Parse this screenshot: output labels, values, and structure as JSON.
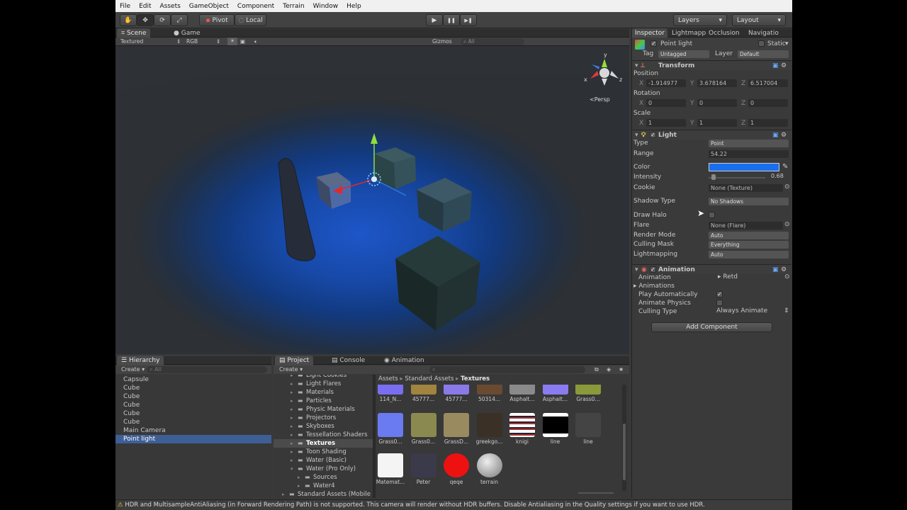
{
  "menubar": {
    "items": [
      "File",
      "Edit",
      "Assets",
      "GameObject",
      "Component",
      "Terrain",
      "Window",
      "Help"
    ]
  },
  "toolbar": {
    "hand_icon": "✋",
    "move_icon": "✥",
    "rotate_icon": "⟳",
    "scale_icon": "⤢",
    "pivot_label": "Pivot",
    "local_label": "Local",
    "play_icon": "▶",
    "pause_icon": "❚❚",
    "step_icon": "▶❚",
    "layers_label": "Layers",
    "layout_label": "Layout"
  },
  "scene_panel": {
    "tab_scene": "Scene",
    "tab_game": "Game",
    "draw_mode": "Textured",
    "channel": "RGB",
    "gizmos": "Gizmos",
    "search_placeholder": "All",
    "persp_label": "Persp",
    "axis_x": "x",
    "axis_z": "z",
    "axis_y": "y"
  },
  "inspector": {
    "tabs": [
      "Inspector",
      "Lightmapp",
      "Occlusion",
      "Navigatio"
    ],
    "object_name": "Point light",
    "static_label": "Static",
    "tag_label": "Tag",
    "tag_value": "Untagged",
    "layer_label": "Layer",
    "layer_value": "Default",
    "transform": {
      "title": "Transform",
      "position_label": "Position",
      "pos_x": "-1.914977",
      "pos_y": "3.678164",
      "pos_z": "6.517004",
      "rotation_label": "Rotation",
      "rot_x": "0",
      "rot_y": "0",
      "rot_z": "0",
      "scale_label": "Scale",
      "scale_x": "1",
      "scale_y": "1",
      "scale_z": "1",
      "x": "X",
      "y": "Y",
      "z": "Z"
    },
    "light": {
      "title": "Light",
      "type_label": "Type",
      "type_value": "Point",
      "range_label": "Range",
      "range_value": "54.22",
      "color_label": "Color",
      "color_value": "#1a6ef0",
      "intensity_label": "Intensity",
      "intensity_value": "0.68",
      "intensity_fraction": 0.085,
      "cookie_label": "Cookie",
      "cookie_value": "None (Texture)",
      "shadow_label": "Shadow Type",
      "shadow_value": "No Shadows",
      "halo_label": "Draw Halo",
      "flare_label": "Flare",
      "flare_value": "None (Flare)",
      "render_label": "Render Mode",
      "render_value": "Auto",
      "culling_label": "Culling Mask",
      "culling_value": "Everything",
      "lightmapping_label": "Lightmapping",
      "lightmapping_value": "Auto"
    },
    "animation": {
      "title": "Animation",
      "animation_label": "Animation",
      "animation_value": "Retd",
      "animations_label": "Animations",
      "play_auto_label": "Play Automatically",
      "physics_label": "Animate Physics",
      "culling_label": "Culling Type",
      "culling_value": "Always Animate"
    },
    "add_component": "Add Component"
  },
  "hierarchy": {
    "tab": "Hierarchy",
    "create": "Create",
    "search_placeholder": "All",
    "items": [
      "Capsule",
      "Cube",
      "Cube",
      "Cube",
      "Cube",
      "Cube",
      "Main Camera",
      "Point light"
    ]
  },
  "project": {
    "tab_project": "Project",
    "tab_console": "Console",
    "tab_animation": "Animation",
    "create": "Create",
    "tree": [
      "Light Cookies",
      "Light Flares",
      "Materials",
      "Particles",
      "Physic Materials",
      "Projectors",
      "Skyboxes",
      "Tessellation Shaders",
      "Textures",
      "Toon Shading",
      "Water (Basic)",
      "Water (Pro Only)",
      "Sources",
      "Water4",
      "Standard Assets (Mobile"
    ],
    "breadcrumb": [
      "Assets",
      "Standard Assets",
      "Textures"
    ],
    "assets_row1": [
      "114_N...",
      "45777...",
      "45777...",
      "50314...",
      "Asphalt...",
      "Asphalt...",
      "Grass0..."
    ],
    "assets_row2": [
      "Grass0...",
      "Grass0...",
      "GrassD...",
      "greekgo...",
      "knigi",
      "line",
      "line"
    ],
    "assets_row3": [
      "Matemat...",
      "Peter",
      "qeqe",
      "terrain"
    ]
  },
  "status": {
    "text": "HDR and MultisampleAntiAliasing (in Forward Rendering Path) is not supported. This camera will render without HDR buffers. Disable Antialiasing in the Quality settings if you want to use HDR."
  },
  "colors": {
    "light_color": "#1a6ef0",
    "selection": "#3e5f96",
    "warning": "#f0c000"
  }
}
